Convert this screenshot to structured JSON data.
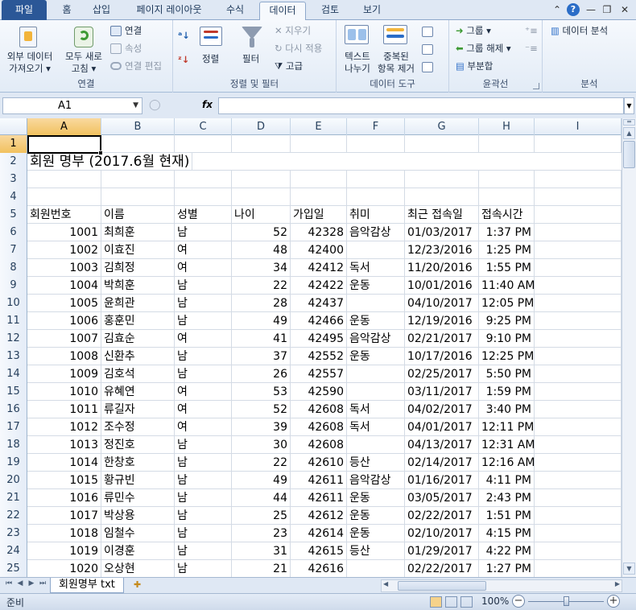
{
  "tabs": {
    "file": "파일",
    "items": [
      "홈",
      "삽입",
      "페이지 레이아웃",
      "수식",
      "데이터",
      "검토",
      "보기"
    ],
    "active": "데이터"
  },
  "ribbon": {
    "connections": {
      "label": "연결",
      "external": "외부 데이터\n가져오기 ▾",
      "external1": "외부 데이터",
      "external2": "가져오기 ▾",
      "refresh1": "모두 새로",
      "refresh2": "고침 ▾",
      "connections": "연결",
      "properties": "속성",
      "edit_links": "연결 편집"
    },
    "sort_filter": {
      "label": "정렬 및 필터",
      "sort": "정렬",
      "filter": "필터",
      "clear": "지우기",
      "reapply": "다시 적용",
      "advanced": "고급"
    },
    "data_tools": {
      "label": "데이터 도구",
      "text_to_columns1": "텍스트",
      "text_to_columns2": "나누기",
      "remove_dup1": "중복된",
      "remove_dup2": "항목 제거"
    },
    "outline": {
      "label": "윤곽선",
      "group": "그룹 ▾",
      "ungroup": "그룹 해제 ▾",
      "subtotal": "부분합"
    },
    "analysis": {
      "label": "분석",
      "data_analysis": "데이터 분석"
    }
  },
  "formula_bar": {
    "name_box": "A1",
    "fx": "fx",
    "value": ""
  },
  "columns": [
    "A",
    "B",
    "C",
    "D",
    "E",
    "F",
    "G",
    "H",
    "I"
  ],
  "selected_cell": "A1",
  "rows": [
    {
      "n": "1",
      "cells": [
        "",
        "",
        "",
        "",
        "",
        "",
        "",
        ""
      ]
    },
    {
      "n": "2",
      "title": "회원 명부 (2017.6월 현재)"
    },
    {
      "n": "3",
      "cells": [
        "",
        "",
        "",
        "",
        "",
        "",
        "",
        ""
      ]
    },
    {
      "n": "4",
      "cells": [
        "",
        "",
        "",
        "",
        "",
        "",
        "",
        ""
      ]
    },
    {
      "n": "5",
      "cells": [
        "회원번호",
        "이름",
        "성별",
        "나이",
        "가입일",
        "취미",
        "최근 접속일",
        "접속시간"
      ]
    },
    {
      "n": "6",
      "cells": [
        "1001",
        "최희훈",
        "남",
        "52",
        "42328",
        "음악감상",
        "01/03/2017",
        "1:37 PM"
      ]
    },
    {
      "n": "7",
      "cells": [
        "1002",
        "이효진",
        "여",
        "48",
        "42400",
        "",
        "12/23/2016",
        "1:25 PM"
      ]
    },
    {
      "n": "8",
      "cells": [
        "1003",
        "김희정",
        "여",
        "34",
        "42412",
        "독서",
        "11/20/2016",
        "1:55 PM"
      ]
    },
    {
      "n": "9",
      "cells": [
        "1004",
        "박희훈",
        "남",
        "22",
        "42422",
        "운동",
        "10/01/2016",
        "11:40 AM"
      ]
    },
    {
      "n": "10",
      "cells": [
        "1005",
        "윤희관",
        "남",
        "28",
        "42437",
        "",
        "04/10/2017",
        "12:05 PM"
      ]
    },
    {
      "n": "11",
      "cells": [
        "1006",
        "홍훈민",
        "남",
        "49",
        "42466",
        "운동",
        "12/19/2016",
        "9:25 PM"
      ]
    },
    {
      "n": "12",
      "cells": [
        "1007",
        "김효순",
        "여",
        "41",
        "42495",
        "음악감상",
        "02/21/2017",
        "9:10 PM"
      ]
    },
    {
      "n": "13",
      "cells": [
        "1008",
        "신환추",
        "남",
        "37",
        "42552",
        "운동",
        "10/17/2016",
        "12:25 PM"
      ]
    },
    {
      "n": "14",
      "cells": [
        "1009",
        "김호석",
        "남",
        "26",
        "42557",
        "",
        "02/25/2017",
        "5:50 PM"
      ]
    },
    {
      "n": "15",
      "cells": [
        "1010",
        "유혜연",
        "여",
        "53",
        "42590",
        "",
        "03/11/2017",
        "1:59 PM"
      ]
    },
    {
      "n": "16",
      "cells": [
        "1011",
        "류길자",
        "여",
        "52",
        "42608",
        "독서",
        "04/02/2017",
        "3:40 PM"
      ]
    },
    {
      "n": "17",
      "cells": [
        "1012",
        "조수정",
        "여",
        "39",
        "42608",
        "독서",
        "04/01/2017",
        "12:11 PM"
      ]
    },
    {
      "n": "18",
      "cells": [
        "1013",
        "정진호",
        "남",
        "30",
        "42608",
        "",
        "04/13/2017",
        "12:31 AM"
      ]
    },
    {
      "n": "19",
      "cells": [
        "1014",
        "한창호",
        "남",
        "22",
        "42610",
        "등산",
        "02/14/2017",
        "12:16 AM"
      ]
    },
    {
      "n": "20",
      "cells": [
        "1015",
        "황규빈",
        "남",
        "49",
        "42611",
        "음악감상",
        "01/16/2017",
        "4:11 PM"
      ]
    },
    {
      "n": "21",
      "cells": [
        "1016",
        "류민수",
        "남",
        "44",
        "42611",
        "운동",
        "03/05/2017",
        "2:43 PM"
      ]
    },
    {
      "n": "22",
      "cells": [
        "1017",
        "박상용",
        "남",
        "25",
        "42612",
        "운동",
        "02/22/2017",
        "1:51 PM"
      ]
    },
    {
      "n": "23",
      "cells": [
        "1018",
        "임철수",
        "남",
        "23",
        "42614",
        "운동",
        "02/10/2017",
        "4:15 PM"
      ]
    },
    {
      "n": "24",
      "cells": [
        "1019",
        "이경훈",
        "남",
        "31",
        "42615",
        "등산",
        "01/29/2017",
        "4:22 PM"
      ]
    },
    {
      "n": "25",
      "cells": [
        "1020",
        "오상현",
        "남",
        "21",
        "42616",
        "",
        "02/22/2017",
        "1:27 PM"
      ]
    }
  ],
  "sheet_tab": "회원명부 txt",
  "status": {
    "ready": "준비",
    "zoom": "100%"
  },
  "icons": [
    "file-icon",
    "refresh-icon",
    "connection-icon",
    "sort-icon",
    "filter-icon",
    "text-columns-icon",
    "remove-duplicates-icon",
    "group-icon",
    "subtotal-icon",
    "analysis-icon"
  ],
  "colors": {
    "file_tab": "#2b5797",
    "selection_header": "#f1c15f",
    "ribbon_bg": "#e2ebf6"
  }
}
